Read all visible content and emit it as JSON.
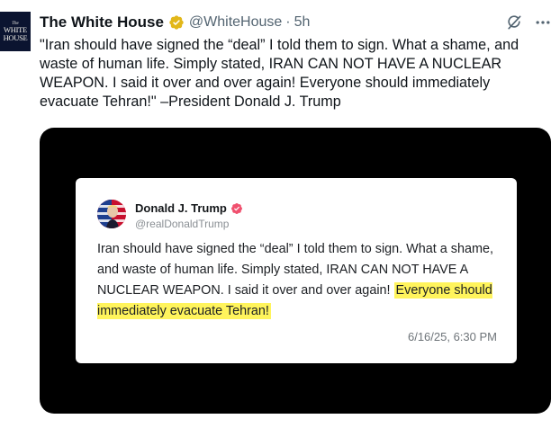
{
  "tweet": {
    "avatar_text": {
      "small": "The",
      "line1": "WHITE",
      "line2": "HOUSE"
    },
    "display_name": "The White House",
    "handle": "@WhiteHouse",
    "separator": "·",
    "time_ago": "5h",
    "text": "\"Iran should have signed the “deal” I told them to sign. What a shame, and waste of human life. Simply stated, IRAN CAN NOT HAVE A NUCLEAR WEAPON. I said it over and over again! Everyone should immediately evacuate Tehran!\" –President Donald J. Trump",
    "icons": {
      "verified": "gold-verified-badge-icon",
      "grok": "grok-icon",
      "more": "more-dots-icon"
    }
  },
  "embedded_post": {
    "author_name": "Donald J. Trump",
    "author_handle": "@realDonaldTrump",
    "text_plain": "Iran should have signed the “deal” I told them to sign. What a shame, and waste of human life. Simply stated, IRAN CAN NOT HAVE A NUCLEAR WEAPON. I said it over and over again!",
    "text_highlighted": "Everyone should immediately evacuate Tehran!",
    "timestamp": "6/16/25, 6:30 PM",
    "colors": {
      "highlight": "#fff45c",
      "verified": "#f0506e"
    }
  },
  "colors": {
    "gold_badge": "#e2b719",
    "muted": "#536471",
    "media_bg": "#000000"
  }
}
